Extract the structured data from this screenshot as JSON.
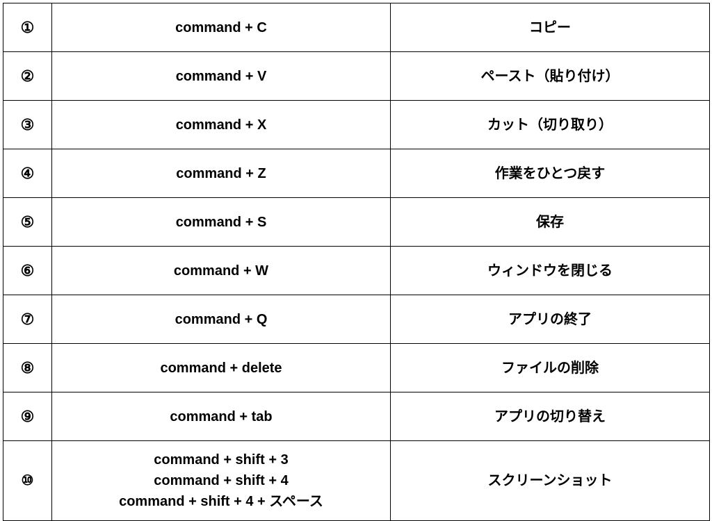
{
  "rows": [
    {
      "number": "①",
      "shortcut": "command + C",
      "description": "コピー"
    },
    {
      "number": "②",
      "shortcut": "command + V",
      "description": "ペースト（貼り付け）"
    },
    {
      "number": "③",
      "shortcut": "command + X",
      "description": "カット（切り取り）"
    },
    {
      "number": "④",
      "shortcut": "command + Z",
      "description": "作業をひとつ戻す"
    },
    {
      "number": "⑤",
      "shortcut": "command + S",
      "description": "保存"
    },
    {
      "number": "⑥",
      "shortcut": "command + W",
      "description": "ウィンドウを閉じる"
    },
    {
      "number": "⑦",
      "shortcut": "command + Q",
      "description": "アプリの終了"
    },
    {
      "number": "⑧",
      "shortcut": "command + delete",
      "description": "ファイルの削除"
    },
    {
      "number": "⑨",
      "shortcut": "command + tab",
      "description": "アプリの切り替え"
    },
    {
      "number": "⑩",
      "shortcut": "command + shift + 3\ncommand + shift + 4\ncommand + shift + 4 + スペース",
      "description": "スクリーンショット"
    }
  ]
}
